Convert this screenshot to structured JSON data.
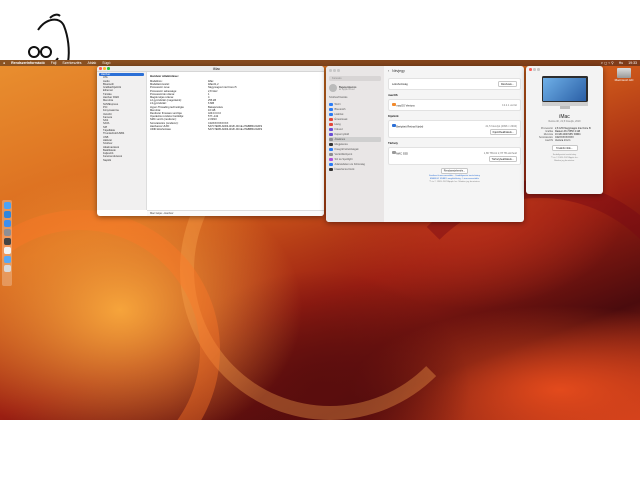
{
  "menubar": {
    "app": "Rendszerinformáció",
    "menus": [
      "Fájl",
      "Szerkesztés",
      "Ablak",
      "Súgó"
    ],
    "right_items": [
      "Hu",
      "19:33"
    ]
  },
  "desktop_icon": {
    "label": "Macintosh HD"
  },
  "system_info": {
    "title": "iMac",
    "sidebar": [
      "Hardver",
      "ATA",
      "Audio",
      "Bluetooth",
      "Grafika/Kijelzők",
      "Ethernet",
      "Tárolás",
      "Hardver RAID",
      "Memória",
      "NVMExpress",
      "PCI",
      "Fénycsatorna",
      "Vezérlő",
      "Kamera",
      "SAS",
      "SATA",
      "SPI",
      "Tápellátás",
      "Thunderbolt/USB4",
      "USB",
      "Hálózat",
      "Szoftver",
      "Alkalmazások",
      "Beállítások",
      "Fejlesztő",
      "Keretrendszerek",
      "Naplók"
    ],
    "heading": "Hardver áttekintése:",
    "rows": [
      [
        "Modellnév:",
        "iMac"
      ],
      [
        "Modellazonosító:",
        "iMac21,2"
      ],
      [
        "Processzor neve:",
        "Négymagos Intel Core i5"
      ],
      [
        "Processzor sebessége:",
        "2,8 GHz"
      ],
      [
        "Processzorok száma:",
        "1"
      ],
      [
        "Magok teljes száma:",
        "4"
      ],
      [
        "L2 gyorsítótár (magonként):",
        "256 kB"
      ],
      [
        "L3 gyorsítótár:",
        "6 MB"
      ],
      [
        "Hyper-Threading technológia:",
        "Bekapcsolva"
      ],
      [
        "Memória:",
        "16 GB"
      ],
      [
        "Rendszer firmware verziója:",
        "429.0.0.0.0"
      ],
      [
        "Operációs rendszer betöltője:",
        "577~142"
      ],
      [
        "SMC verzió (rendszer):",
        "2.33f10"
      ],
      [
        "Sorozatszám (rendszer):",
        "C02XXXXXXXXX"
      ],
      [
        "Hardveres UUID:",
        "5A7C7E0B-A6D3-4F2F-9C1E-27E8B8C2A6F9"
      ],
      [
        "UDID létrehozása:",
        "5A7C7E0B-A6D3-4F2F-9C1E-27E8B8C2A6F9"
      ]
    ],
    "footer": "Mac Gépe › Hardver"
  },
  "settings": {
    "search_placeholder": "Keresés",
    "user_name": "Bejelentkezés",
    "user_sub": "az Apple ID-vel",
    "sidebar_header": "Szoftverfrissítés",
    "sidebar": [
      {
        "label": "Wi-Fi",
        "color": "#2b7cf6"
      },
      {
        "label": "Bluetooth",
        "color": "#2b7cf6"
      },
      {
        "label": "Hálózat",
        "color": "#2b7cf6"
      },
      {
        "label": "Értesítések",
        "color": "#e3463a"
      },
      {
        "label": "Hang",
        "color": "#e3463a"
      },
      {
        "label": "Fókusz",
        "color": "#6b4ed6"
      },
      {
        "label": "Képernyőidő",
        "color": "#6b4ed6"
      },
      {
        "label": "Általános",
        "color": "#8e8e93",
        "selected": true
      },
      {
        "label": "Megjelenés",
        "color": "#333"
      },
      {
        "label": "Kisegítő lehetőségek",
        "color": "#2b7cf6"
      },
      {
        "label": "Vezérlőközpont",
        "color": "#8e8e93"
      },
      {
        "label": "Siri és Spotlight",
        "color": "#b04fe0"
      },
      {
        "label": "Adatvédelem és biztonság",
        "color": "#2b7cf6"
      },
      {
        "label": "Íróasztal és Dock",
        "color": "#333"
      }
    ],
    "header": "Névjegy",
    "name_label": "Létrehozóság",
    "name_button": "Részletek...",
    "macos_title": "macOS",
    "macos_name": "macOS Ventura",
    "macos_version": "13.2.1 verzió",
    "displays_title": "Kijelzők",
    "display_name": "Beépített Retina Kijelző",
    "display_res": "21,5 hüvelyk (4096 × 2304)",
    "display_button": "Kijelzőbeállítások...",
    "storage_title": "Tárhely",
    "storage_name": "MAC SSD",
    "storage_val": "1,86 TB-ból 2,78 TB elérhető",
    "storage_button": "Tárhelybeállítások...",
    "report_button": "Rendszerjelentés...",
    "links_1": "Szoftver-licencszerződés · Szabályozási tanúsítvány",
    "links_2": "ENERGY STAR® megfelelőség · Licencszerződés",
    "links_3": "™ és © 1983–2023 Apple Inc. Minden jog fenntartva."
  },
  "about": {
    "title": "iMac",
    "subtitle": "Retina 4K, 21,5 hüvelyk, 2019",
    "specs": [
      [
        "Processzor",
        "2,8 GHz Négymagos Intel Core i5"
      ],
      [
        "Grafika",
        "Radeon Pro 555X 2 GB"
      ],
      [
        "Memória",
        "16 GB 2400 MHz DDR4"
      ],
      [
        "Sorozatszám",
        "C02XXXXXXXXX"
      ],
      [
        "macOS",
        "Ventura 13.2.1"
      ]
    ],
    "more_button": "További infók...",
    "footer_1": "Szabályozási tanúsítvány",
    "footer_2": "™ és © 1983–2023 Apple Inc.",
    "footer_3": "Minden jog fenntartva."
  }
}
